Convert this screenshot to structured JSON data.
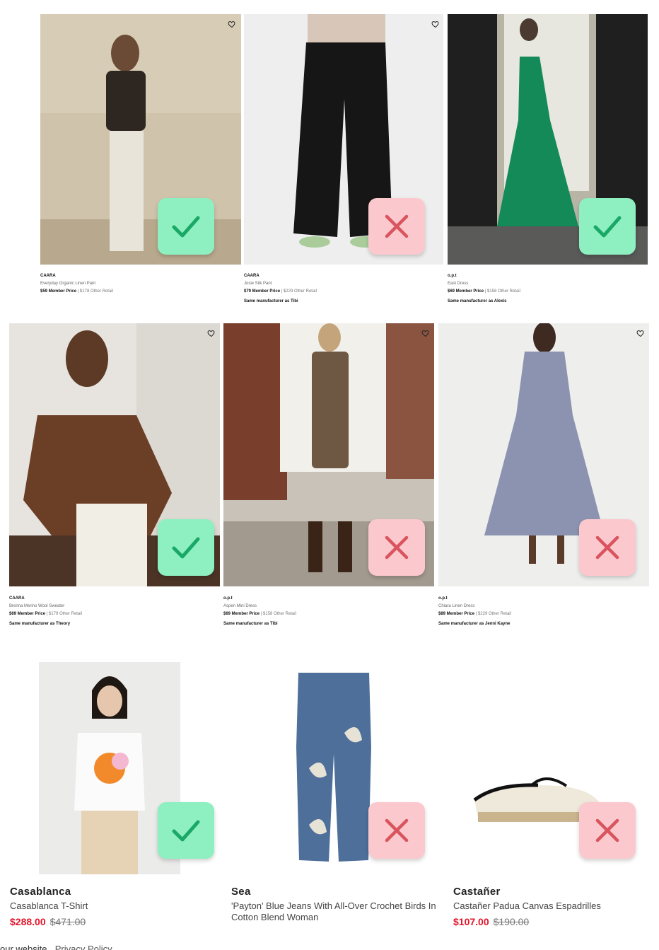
{
  "row1": [
    {
      "brand": "CAARA",
      "name": "Everyday Organic Linen Pant",
      "member_price": "$59 Member Price",
      "other_price": "| $178 Other Retail",
      "manufacturer": "",
      "verdict": "ok"
    },
    {
      "brand": "CAARA",
      "name": "Josie Silk Pant",
      "member_price": "$79 Member Price",
      "other_price": "| $229 Other Retail",
      "manufacturer": "Same manufacturer as Tibi",
      "verdict": "no"
    },
    {
      "brand": "o.p.t",
      "name": "East Dress",
      "member_price": "$69 Member Price",
      "other_price": "| $158 Other Retail",
      "manufacturer": "Same manufacturer as Alexis",
      "verdict": "ok"
    }
  ],
  "row2": [
    {
      "brand": "CAARA",
      "name": "Brenna Merino Wool Sweater",
      "member_price": "$69 Member Price",
      "other_price": "| $179 Other Retail",
      "manufacturer": "Same manufacturer as Theory",
      "verdict": "ok"
    },
    {
      "brand": "o.p.t",
      "name": "Aspen Mini Dress",
      "member_price": "$69 Member Price",
      "other_price": "| $158 Other Retail",
      "manufacturer": "Same manufacturer as Tibi",
      "verdict": "no"
    },
    {
      "brand": "o.p.t",
      "name": "Chiara Linen Dress",
      "member_price": "$89 Member Price",
      "other_price": "| $229 Other Retail",
      "manufacturer": "Same manufacturer as Jenni Kayne",
      "verdict": "no"
    }
  ],
  "row3": [
    {
      "brand": "Casablanca",
      "name": "Casablanca T-Shirt",
      "sale_price": "$288.00",
      "orig_price": "$471.00",
      "verdict": "ok"
    },
    {
      "brand": "Sea",
      "name": "'Payton' Blue Jeans With All-Over Crochet Birds In Cotton Blend Woman",
      "sale_price": "",
      "orig_price": "",
      "verdict": "no"
    },
    {
      "brand": "Castañer",
      "name": "Castañer Padua Canvas Espadrilles",
      "sale_price": "$107.00",
      "orig_price": "$190.00",
      "verdict": "no"
    }
  ],
  "footer": {
    "text": "our website.",
    "link": "Privacy Policy"
  },
  "icons": {
    "favorite": "heart-icon",
    "approve": "check-icon",
    "reject": "x-icon"
  },
  "colors": {
    "approve_bg": "#8ef0c0",
    "approve_fg": "#1aa866",
    "reject_bg": "#fbc9cd",
    "reject_fg": "#d9545e",
    "sale": "#e2162b"
  }
}
